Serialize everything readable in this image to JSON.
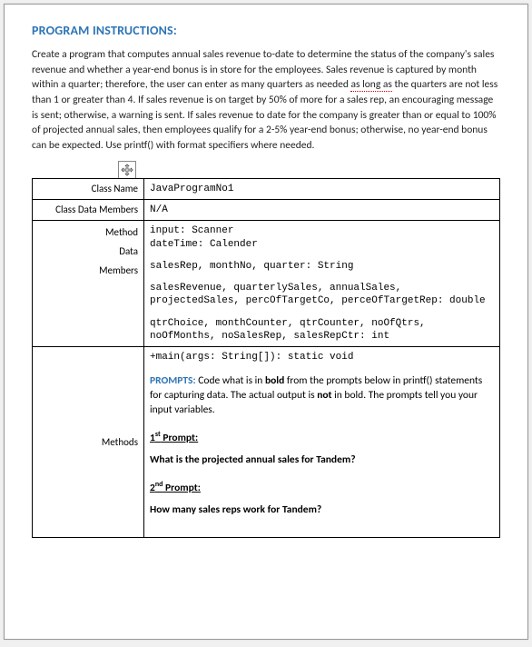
{
  "heading": "PROGRAM INSTRUCTIONS:",
  "intro_before": "Create a program that computes annual sales revenue to-date to determine the status of the company's sales revenue and whether a year-end bonus is in store for the employees.  Sales revenue is captured by month within a quarter; therefore, the user can enter as many quarters as needed ",
  "intro_err": "as long as",
  "intro_after": " the quarters are not less than 1 or greater than 4.  If sales revenue is on target by 50% of more for a sales rep, an encouraging message is sent; otherwise, a warning is sent. If sales revenue to date for the company is greater than or equal to 100% of projected annual sales, then employees qualify for a 2-5% year-end bonus; otherwise, no year-end bonus can be expected.  Use printf() with format specifiers where needed.",
  "rows": {
    "class_name": {
      "label": "Class Name",
      "value": "JavaProgramNo1"
    },
    "class_data_members": {
      "label": "Class Data Members",
      "value": "N/A"
    },
    "method_data_members": {
      "label1": "Method",
      "label2": "Data",
      "label3": "Members",
      "line1": "input:  Scanner",
      "line2": "dateTime: Calender",
      "line3": "salesRep, monthNo, quarter:   String",
      "line4": "salesRevenue, quarterlySales, annualSales, projectedSales, percOfTargetCo, perceOfTargetRep:   double",
      "line5": "qtrChoice, monthCounter, qtrCounter, noOfQtrs, noOfMonths, noSalesRep, salesRepCtr:   int"
    },
    "methods": {
      "label": "Methods",
      "sig": "+main(args:  String[]):  static void",
      "prompts_label": "PROMPTS:",
      "prompts_text_a": "  Code what is in ",
      "prompts_bold1": "bold",
      "prompts_text_b": " from the prompts below in printf() statements for capturing data.  The actual output is ",
      "prompts_bold2": "not",
      "prompts_text_c": " in bold.  The prompts tell you your input variables.",
      "p1_label_a": "1",
      "p1_label_sup": "st",
      "p1_label_b": " Prompt:",
      "p1_text": "What is the projected annual sales for Tandem?",
      "p2_label_a": "2",
      "p2_label_sup": "nd",
      "p2_label_b": " Prompt:",
      "p2_text": "How many sales reps work for Tandem?"
    }
  }
}
